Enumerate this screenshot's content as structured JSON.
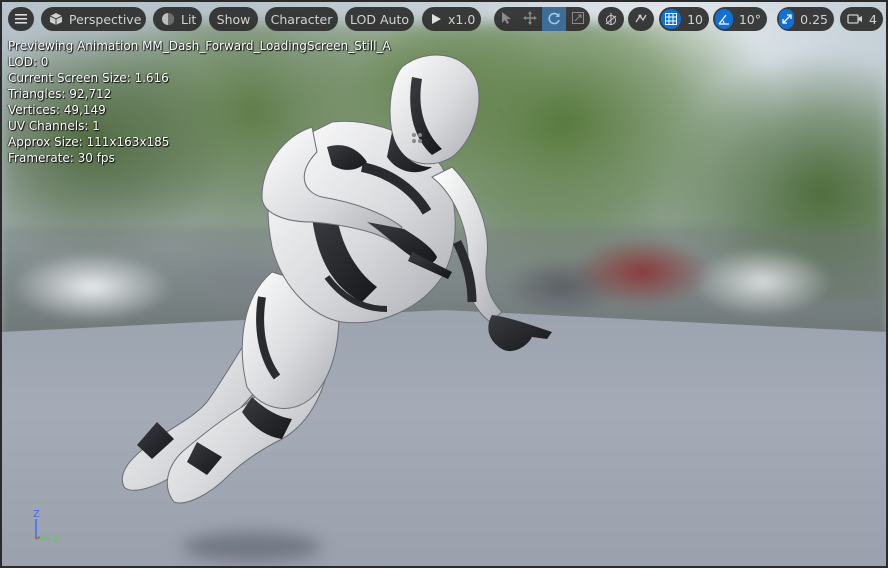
{
  "toolbar": {
    "menu_icon": "hamburger-icon",
    "perspective_label": "Perspective",
    "lit_label": "Lit",
    "show_label": "Show",
    "character_label": "Character",
    "lod_label": "LOD Auto",
    "play_speed_label": "x1.0",
    "grid_snap_value": "10",
    "rotation_snap_value": "10°",
    "scale_snap_value": "0.25",
    "camera_speed_value": "4"
  },
  "stats": {
    "previewing": "Previewing Animation MM_Dash_Forward_LoadingScreen_Still_A",
    "lod": "LOD: 0",
    "screen_size": "Current Screen Size: 1.616",
    "triangles": "Triangles: 92,712",
    "vertices": "Vertices: 49,149",
    "uv_channels": "UV Channels: 1",
    "approx_size": "Approx Size: 111x163x185",
    "framerate": "Framerate: 30 fps"
  },
  "axis": {
    "z": "Z",
    "x": "X"
  },
  "colors": {
    "accent_blue": "#0f71d8",
    "axis_z": "#3f6cf5",
    "axis_x": "#5bd048",
    "axis_y": "#d24c4c"
  }
}
